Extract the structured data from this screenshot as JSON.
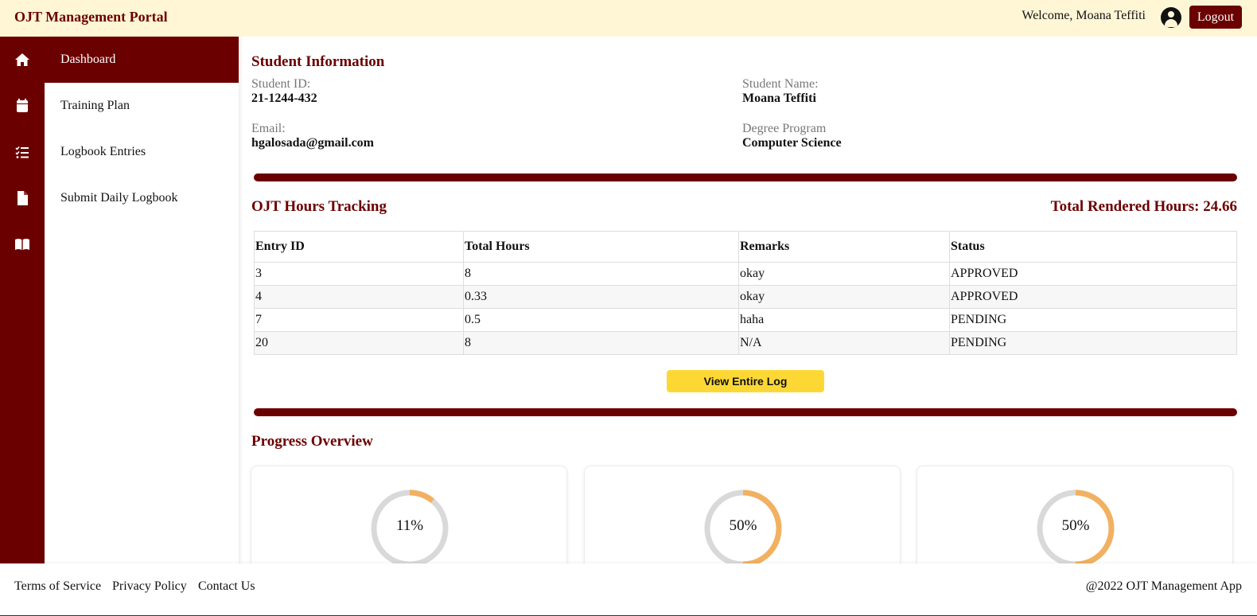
{
  "header": {
    "brand": "OJT Management Portal",
    "welcome": "Welcome, Moana Teffiti",
    "logout_label": "Logout"
  },
  "sidebar": {
    "items": [
      {
        "label": "Dashboard",
        "icon": "home-icon",
        "active": true
      },
      {
        "label": "Training Plan",
        "icon": "calendar-icon",
        "active": false
      },
      {
        "label": "Logbook Entries",
        "icon": "checklist-icon",
        "active": false
      },
      {
        "label": "Submit Daily Logbook",
        "icon": "file-icon",
        "active": false
      },
      {
        "label": "",
        "icon": "book-icon",
        "active": false
      }
    ]
  },
  "student_info": {
    "title": "Student Information",
    "id_label": "Student ID:",
    "id_value": "21-1244-432",
    "name_label": "Student Name:",
    "name_value": "Moana Teffiti",
    "email_label": "Email:",
    "email_value": "hgalosada@gmail.com",
    "degree_label": "Degree Program",
    "degree_value": "Computer Science"
  },
  "hours": {
    "title": "OJT Hours Tracking",
    "total_text": "Total Rendered Hours: 24.66",
    "columns": [
      "Entry ID",
      "Total Hours",
      "Remarks",
      "Status"
    ],
    "rows": [
      [
        "3",
        "8",
        "okay",
        "APPROVED"
      ],
      [
        "4",
        "0.33",
        "okay",
        "APPROVED"
      ],
      [
        "7",
        "0.5",
        "haha",
        "PENDING"
      ],
      [
        "20",
        "8",
        "N/A",
        "PENDING"
      ]
    ],
    "view_log_label": "View Entire Log"
  },
  "progress": {
    "title": "Progress Overview",
    "cards": [
      {
        "percent_label": "11%",
        "percent": 11
      },
      {
        "percent_label": "50%",
        "percent": 50
      },
      {
        "percent_label": "50%",
        "percent": 50
      }
    ],
    "track_color": "#d9d9d9",
    "fill_color": "#f2b160"
  },
  "footer": {
    "links": [
      "Terms of Service",
      "Privacy Policy",
      "Contact Us"
    ],
    "copyright": "@2022 OJT Management App"
  },
  "colors": {
    "primary": "#6b0000",
    "header_bg": "#fff6d6",
    "button_yellow": "#fdd835"
  }
}
